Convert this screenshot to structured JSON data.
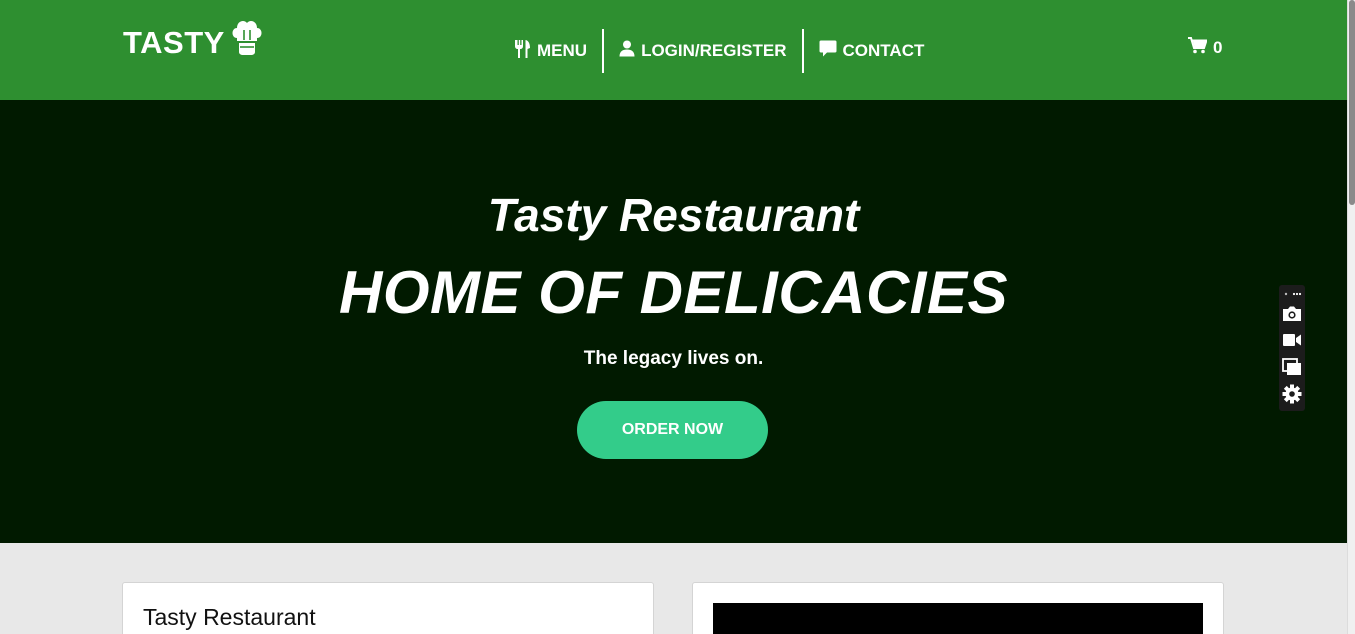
{
  "brand": {
    "name": "TASTY",
    "icon": "chef-hat-icon"
  },
  "nav": {
    "items": [
      {
        "label": "MENU",
        "icon": "utensils-icon"
      },
      {
        "label": "LOGIN/REGISTER",
        "icon": "user-icon"
      },
      {
        "label": "CONTACT",
        "icon": "comment-icon"
      }
    ],
    "cart_count": "0"
  },
  "hero": {
    "subtitle": "Tasty Restaurant",
    "title": "HOME OF DELICACIES",
    "tagline": "The legacy lives on.",
    "button": "ORDER NOW"
  },
  "content": {
    "card_title": "Tasty Restaurant"
  },
  "toolbar": {
    "items": [
      "camera-icon",
      "video-icon",
      "windows-icon",
      "gear-icon"
    ]
  },
  "colors": {
    "nav_bg": "#2e8f30",
    "hero_bg": "#011a00",
    "accent": "#33cc8a",
    "page_bg": "#e8e8e8"
  }
}
